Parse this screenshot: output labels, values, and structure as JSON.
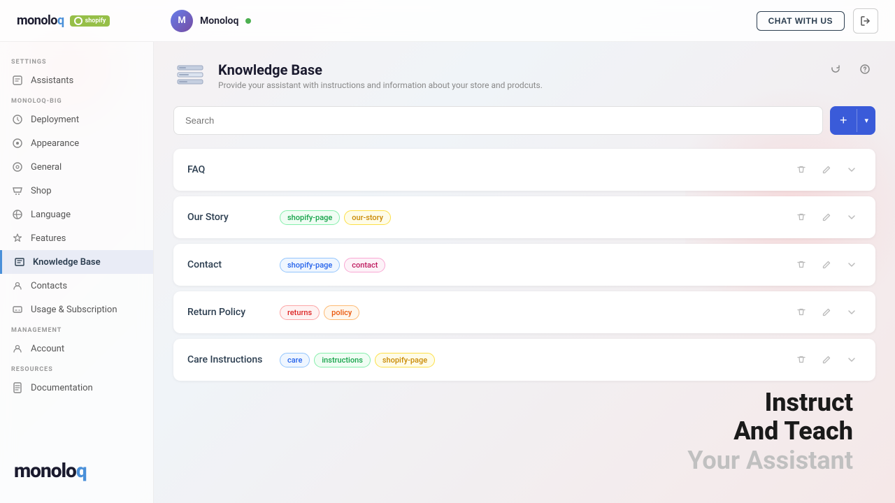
{
  "header": {
    "logo": "monoloq",
    "logo_suffix": "q",
    "shopify_label": "shopify",
    "user_name": "Monoloq",
    "user_initial": "M",
    "chat_btn": "CHAT WITH US",
    "status": "online"
  },
  "sidebar": {
    "sections": [
      {
        "label": "SETTINGS",
        "items": [
          {
            "id": "assistants",
            "label": "Assistants",
            "icon": "📋"
          }
        ]
      },
      {
        "label": "MONOLOQ-BIG",
        "items": [
          {
            "id": "deployment",
            "label": "Deployment",
            "icon": "🚀"
          },
          {
            "id": "appearance",
            "label": "Appearance",
            "icon": "🎨"
          },
          {
            "id": "general",
            "label": "General",
            "icon": "⚙️"
          },
          {
            "id": "shop",
            "label": "Shop",
            "icon": "🛍️"
          },
          {
            "id": "language",
            "label": "Language",
            "icon": "🌐"
          },
          {
            "id": "features",
            "label": "Features",
            "icon": "✨"
          },
          {
            "id": "knowledge-base",
            "label": "Knowledge Base",
            "icon": "📚",
            "active": true
          },
          {
            "id": "contacts",
            "label": "Contacts",
            "icon": "👥"
          },
          {
            "id": "usage-subscription",
            "label": "Usage & Subscription",
            "icon": "💳"
          }
        ]
      },
      {
        "label": "MANAGEMENT",
        "items": [
          {
            "id": "account",
            "label": "Account",
            "icon": "👤"
          }
        ]
      },
      {
        "label": "RESOURCES",
        "items": [
          {
            "id": "documentation",
            "label": "Documentation",
            "icon": "📄"
          }
        ]
      }
    ]
  },
  "main": {
    "page_title": "Knowledge Base",
    "page_subtitle": "Provide your assistant with instructions and information about your store and prodcuts.",
    "search_placeholder": "Search",
    "add_btn": "+",
    "knowledge_items": [
      {
        "id": "faq",
        "name": "FAQ",
        "tags": []
      },
      {
        "id": "our-story",
        "name": "Our Story",
        "tags": [
          {
            "label": "shopify-page",
            "color": "green"
          },
          {
            "label": "our-story",
            "color": "yellow"
          }
        ]
      },
      {
        "id": "contact",
        "name": "Contact",
        "tags": [
          {
            "label": "shopify-page",
            "color": "blue"
          },
          {
            "label": "contact",
            "color": "pink"
          }
        ]
      },
      {
        "id": "return-policy",
        "name": "Return Policy",
        "tags": [
          {
            "label": "returns",
            "color": "red"
          },
          {
            "label": "policy",
            "color": "orange"
          }
        ]
      },
      {
        "id": "care-instructions",
        "name": "Care Instructions",
        "tags": [
          {
            "label": "care",
            "color": "blue"
          },
          {
            "label": "instructions",
            "color": "green"
          },
          {
            "label": "shopify-page",
            "color": "yellow"
          }
        ]
      }
    ]
  },
  "tagline": {
    "line1": "Instruct",
    "line2": "And Teach",
    "line3": "Your Assistant"
  },
  "bottom_logo": "monoloq"
}
